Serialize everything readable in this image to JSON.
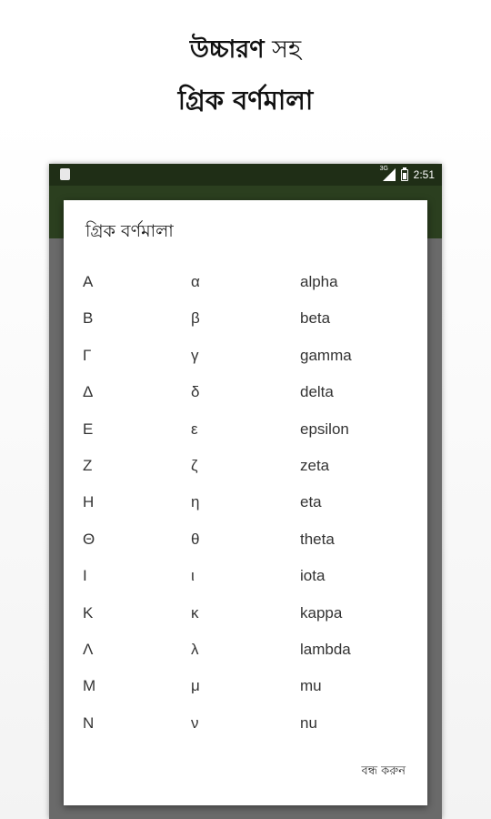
{
  "promo": {
    "line1_bold": "উচ্চারণ",
    "line1_light": " সহ",
    "line2": "গ্রিক বর্ণমালা"
  },
  "status_bar": {
    "network_label": "3G",
    "time": "2:51"
  },
  "dialog": {
    "title": "গ্রিক বর্ণমালা",
    "close_label": "বন্ধ করুন",
    "letters": [
      {
        "upper": "Α",
        "lower": "α",
        "name": "alpha"
      },
      {
        "upper": "Β",
        "lower": "β",
        "name": "beta"
      },
      {
        "upper": "Γ",
        "lower": "γ",
        "name": "gamma"
      },
      {
        "upper": "Δ",
        "lower": "δ",
        "name": "delta"
      },
      {
        "upper": "Ε",
        "lower": "ε",
        "name": "epsilon"
      },
      {
        "upper": "Ζ",
        "lower": "ζ",
        "name": "zeta"
      },
      {
        "upper": "Η",
        "lower": "η",
        "name": "eta"
      },
      {
        "upper": "Θ",
        "lower": "θ",
        "name": "theta"
      },
      {
        "upper": "Ι",
        "lower": "ι",
        "name": "iota"
      },
      {
        "upper": "Κ",
        "lower": "κ",
        "name": "kappa"
      },
      {
        "upper": "Λ",
        "lower": "λ",
        "name": "lambda"
      },
      {
        "upper": "Μ",
        "lower": "μ",
        "name": "mu"
      },
      {
        "upper": "Ν",
        "lower": "ν",
        "name": "nu"
      }
    ]
  },
  "colors": {
    "app_bar": "#2b3f1f",
    "status_bar": "#1f2e16",
    "scrim": "#6a6a6a"
  },
  "icons": {
    "status_left": "notification-icon",
    "signal": "signal-icon",
    "battery": "battery-icon"
  }
}
